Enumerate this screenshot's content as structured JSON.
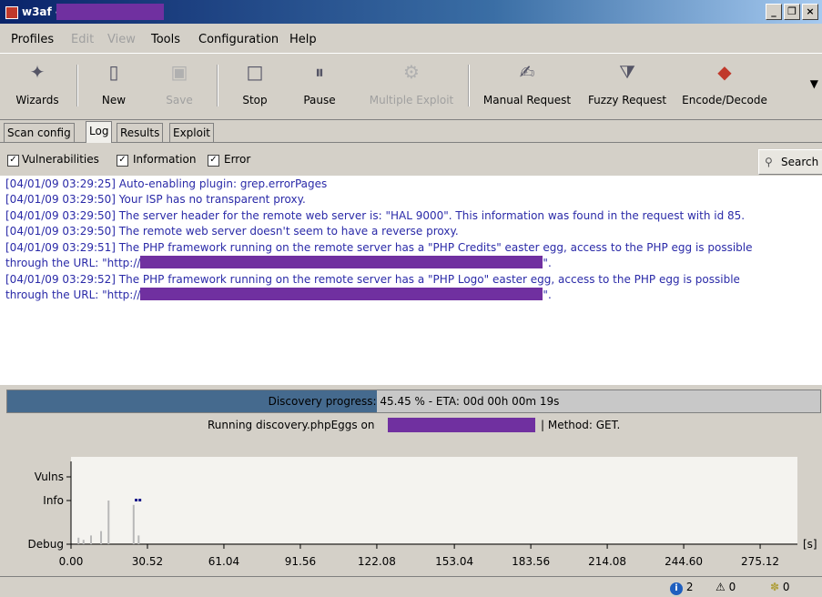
{
  "window": {
    "title": "w3af -"
  },
  "menu": [
    "Profiles",
    "Edit",
    "View",
    "Tools",
    "Configuration",
    "Help"
  ],
  "toolbar": {
    "wizards": "Wizards",
    "new": "New",
    "save": "Save",
    "stop": "Stop",
    "pause": "Pause",
    "multiple_exploit": "Multiple Exploit",
    "manual_request": "Manual Request",
    "fuzzy_request": "Fuzzy Request",
    "encode_decode": "Encode/Decode"
  },
  "tabs": [
    "Scan config",
    "Log",
    "Results",
    "Exploit"
  ],
  "filters": {
    "vulnerabilities": "Vulnerabilities",
    "information": "Information",
    "error": "Error",
    "search": "Search"
  },
  "log": [
    "[04/01/09 03:29:25] Auto-enabling plugin: grep.errorPages",
    "[04/01/09 03:29:50] Your ISP has no transparent proxy.",
    "[04/01/09 03:29:50] The server header for the remote web server is: \"HAL 9000\". This information was found in the request with id 85.",
    "[04/01/09 03:29:50] The remote web server doesn't seem to have a reverse proxy.",
    "[04/01/09 03:29:51] The PHP framework running on the remote server has a \"PHP Credits\" easter egg, access to the PHP egg is possible",
    "through the URL: \"http://",
    "[04/01/09 03:29:52] The PHP framework running on the remote server has a \"PHP Logo\" easter egg, access to the PHP egg is possible",
    "through the URL: \"http://"
  ],
  "log_tail": "\".",
  "progress": {
    "label": "Discovery progress: 45.45 % - ETA: 00d 00h 00m 19s",
    "fraction": 0.4545
  },
  "running": {
    "prefix": "Running discovery.phpEggs on",
    "suffix": "| Method: GET."
  },
  "chart_data": {
    "type": "scatter",
    "y_categories": [
      "Vulns",
      "Info",
      "Debug"
    ],
    "x_ticks": [
      "0.00",
      "30.52",
      "61.04",
      "91.56",
      "122.08",
      "153.04",
      "183.56",
      "214.08",
      "244.60",
      "275.12"
    ],
    "xlim": [
      0,
      290
    ],
    "xunit": "[s]",
    "debug_bars": [
      {
        "x": 3,
        "h": 0.15
      },
      {
        "x": 5,
        "h": 0.1
      },
      {
        "x": 8,
        "h": 0.2
      },
      {
        "x": 12,
        "h": 0.3
      },
      {
        "x": 15,
        "h": 1.0
      },
      {
        "x": 25,
        "h": 0.9
      },
      {
        "x": 27,
        "h": 0.2
      }
    ],
    "info_points": [
      26,
      27.5
    ]
  },
  "status": {
    "info_count": "2",
    "warn_count": "0",
    "error_count": "0"
  }
}
